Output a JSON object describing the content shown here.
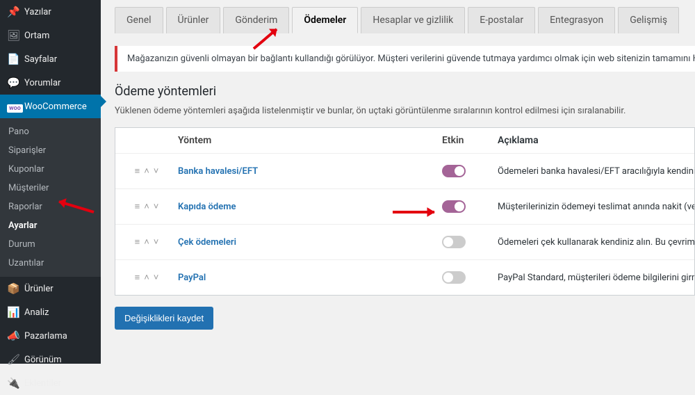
{
  "sidebar": {
    "items": [
      {
        "icon": "📌",
        "label": "Yazılar"
      },
      {
        "icon": "🖼",
        "label": "Ortam"
      },
      {
        "icon": "📄",
        "label": "Sayfalar"
      },
      {
        "icon": "💬",
        "label": "Yorumlar"
      }
    ],
    "woo": "WooCommerce",
    "sub": [
      "Pano",
      "Siparişler",
      "Kuponlar",
      "Müşteriler",
      "Raporlar",
      "Ayarlar",
      "Durum",
      "Uzantılar"
    ],
    "after": [
      {
        "icon": "📦",
        "label": "Ürünler"
      },
      {
        "icon": "📊",
        "label": "Analiz"
      },
      {
        "icon": "📣",
        "label": "Pazarlama"
      },
      {
        "icon": "🖌",
        "label": "Görünüm"
      },
      {
        "icon": "🔌",
        "label": "Eklentiler"
      }
    ]
  },
  "tabs": [
    "Genel",
    "Ürünler",
    "Gönderim",
    "Ödemeler",
    "Hesaplar ve gizlilik",
    "E-postalar",
    "Entegrasyon",
    "Gelişmiş"
  ],
  "notice": "Mağazanızın güvenli olmayan bir bağlantı kullandığı görülüyor. Müşteri verilerini güvende tutmaya yardımcı olmak için web sitenizin tamamını HTTPS bağl",
  "heading": "Ödeme yöntemleri",
  "description": "Yüklenen ödeme yöntemleri aşağıda listelenmiştir ve bunlar, ön uçtaki görüntülenme sıralarının kontrol edilmesi için sıralanabilir.",
  "columns": {
    "method": "Yöntem",
    "enabled": "Etkin",
    "desc": "Açıklama"
  },
  "rows": [
    {
      "name": "Banka havalesi/EFT",
      "enabled": true,
      "desc": "Ödemeleri banka havalesi/EFT aracılığıyla kendiniz al"
    },
    {
      "name": "Kapıda ödeme",
      "enabled": true,
      "desc": "Müşterilerinizin ödemeyi teslimat anında nakit (veya b"
    },
    {
      "name": "Çek ödemeleri",
      "enabled": false,
      "desc": "Ödemeleri çek kullanarak kendiniz alın. Bu çevrimdışı"
    },
    {
      "name": "PayPal",
      "enabled": false,
      "desc": "PayPal Standard, müşterileri ödeme bilgilerini girmeye"
    }
  ],
  "save": "Değişiklikleri kaydet"
}
